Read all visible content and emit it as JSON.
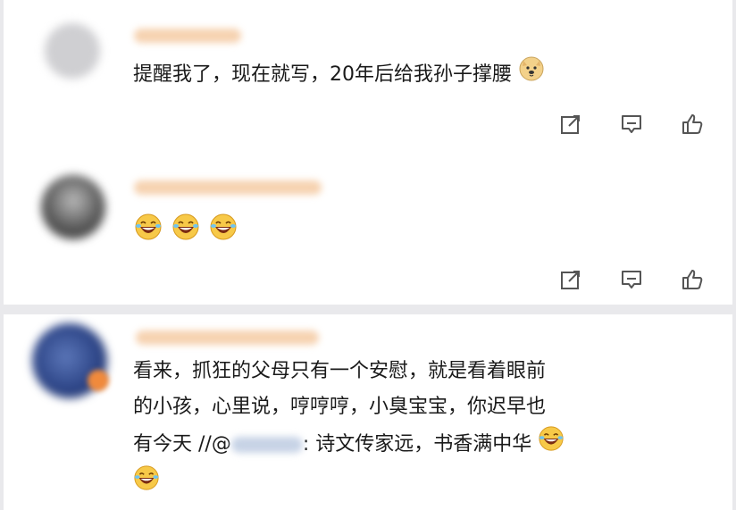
{
  "comments": [
    {
      "text": "提醒我了，现在就写，20年后给我孙子撑腰",
      "trailing_emoji": "doge-emoji"
    },
    {
      "emojis": [
        "laugh-cry-emoji",
        "laugh-cry-emoji",
        "laugh-cry-emoji"
      ]
    },
    {
      "lines": [
        "看来，抓狂的父母只有一个安慰，就是看着眼前",
        "的小孩，心里说，哼哼哼，小臭宝宝，你迟早也",
        "有今天 //@"
      ],
      "after_mention": ": 诗文传家远，书香满中华",
      "trailing_emoji": "laugh-cry-emoji"
    }
  ],
  "action_icons": [
    "share-icon",
    "comment-icon",
    "like-icon"
  ],
  "colors": {
    "avatar_1": "#d9d9dc",
    "avatar_2": "#5a5a5a",
    "avatar_3": "#2f4a8f",
    "name_blur": "#f5cfa8",
    "divider": "#ececec"
  }
}
